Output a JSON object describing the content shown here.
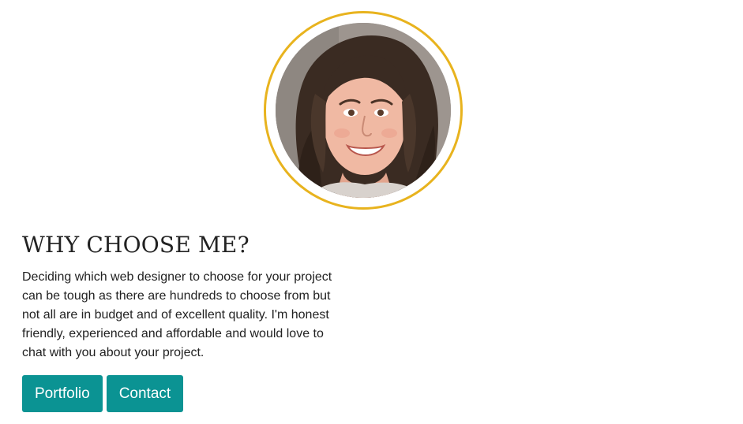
{
  "profile": {
    "photo_alt": "Portrait photo",
    "ring_color": "#e8b31e"
  },
  "section": {
    "heading": "WHY CHOOSE ME?",
    "body": "Deciding which web designer to choose for your project can be tough as there are hundreds to choose from but not all are in budget and of excellent quality. I'm honest friendly, experienced and affordable and would love to chat with you about your project."
  },
  "buttons": {
    "portfolio_label": "Portfolio",
    "contact_label": "Contact",
    "color": "#0b9393"
  }
}
